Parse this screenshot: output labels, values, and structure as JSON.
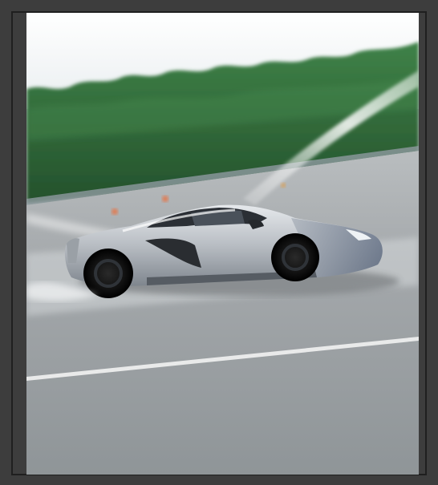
{
  "photo": {
    "subject": "silver-sports-car",
    "colors": {
      "sky": "#f4f7f8",
      "trees": "#2f6a3a",
      "tarmac": "#9ea3a6",
      "car_body": "#c9cdd2",
      "frame": "#3d3d3d"
    }
  }
}
